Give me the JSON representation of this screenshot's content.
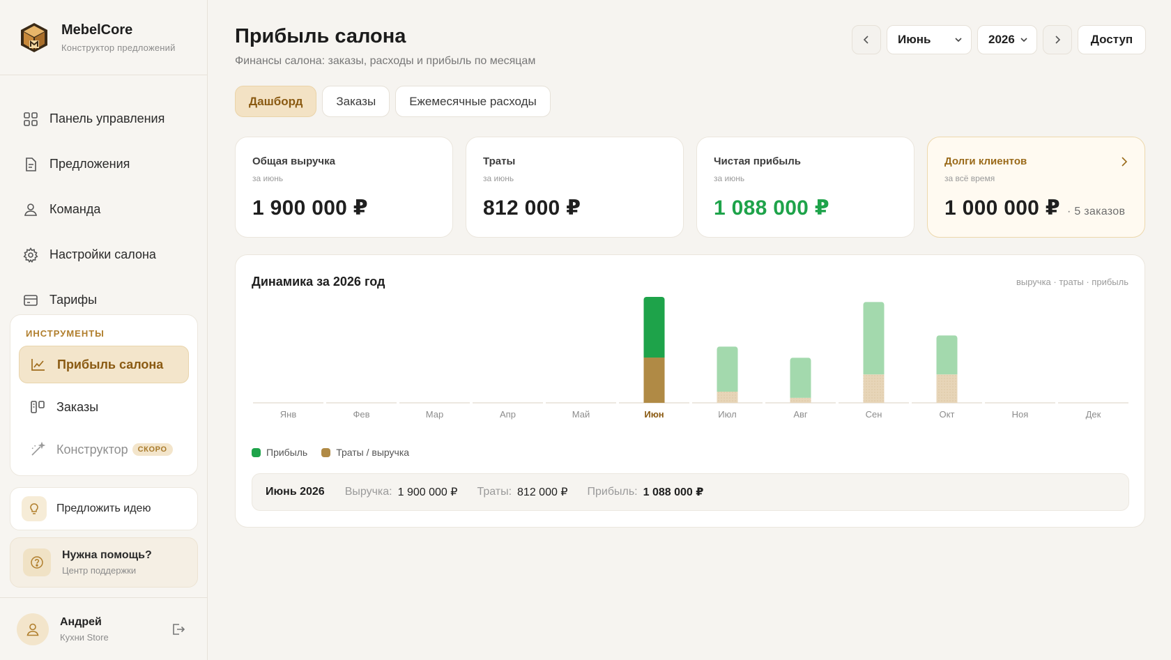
{
  "brand": {
    "name": "MebelCore",
    "subtitle": "Конструктор предложений"
  },
  "nav": [
    {
      "label": "Панель управления",
      "icon": "dashboard-icon"
    },
    {
      "label": "Предложения",
      "icon": "document-icon"
    },
    {
      "label": "Команда",
      "icon": "team-icon"
    },
    {
      "label": "Настройки салона",
      "icon": "gear-icon"
    },
    {
      "label": "Тарифы",
      "icon": "card-icon"
    }
  ],
  "tools": {
    "title": "ИНСТРУМЕНТЫ",
    "items": [
      {
        "label": "Прибыль салона",
        "icon": "chart-line-icon",
        "active": true
      },
      {
        "label": "Заказы",
        "icon": "kanban-icon"
      },
      {
        "label": "Конструктор",
        "icon": "wand-icon",
        "badge": "СКОРО"
      }
    ]
  },
  "idea": {
    "label": "Предложить идею",
    "icon": "bulb-icon"
  },
  "help": {
    "title": "Нужна помощь?",
    "subtitle": "Центр поддержки",
    "icon": "question-icon"
  },
  "user": {
    "name": "Андрей",
    "org": "Кухни Store"
  },
  "header": {
    "title": "Прибыль салона",
    "subtitle": "Финансы салона: заказы, расходы и прибыль по месяцам",
    "month": "Июнь",
    "year": "2026",
    "access_label": "Доступ"
  },
  "tabs": [
    {
      "label": "Дашборд",
      "active": true
    },
    {
      "label": "Заказы",
      "active": false
    },
    {
      "label": "Ежемесячные расходы",
      "active": false
    }
  ],
  "kpis": [
    {
      "label": "Общая выручка",
      "period": "за июнь",
      "value": "1 900 000 ₽"
    },
    {
      "label": "Траты",
      "period": "за июнь",
      "value": "812 000 ₽"
    },
    {
      "label": "Чистая прибыль",
      "period": "за июнь",
      "value": "1 088 000 ₽"
    },
    {
      "label": "Долги клиентов",
      "period": "за всё время",
      "value": "1 000 000 ₽",
      "extra": "· 5 заказов"
    }
  ],
  "colors": {
    "accent": "#b08a4a",
    "profit_active": "#1ea34a",
    "profit_muted": "#a3d9ad",
    "spend_active": "#b08a45",
    "spend_muted": "#e7d5b8"
  },
  "chart_data": {
    "type": "bar",
    "title": "Динамика за 2026 год",
    "note": "выручка · траты · прибыль",
    "categories": [
      "Янв",
      "Фев",
      "Мар",
      "Апр",
      "Май",
      "Июн",
      "Июл",
      "Авг",
      "Сен",
      "Окт",
      "Ноя",
      "Дек"
    ],
    "selected": "Июн",
    "series": [
      {
        "name": "Прибыль",
        "values": [
          0,
          0,
          0,
          0,
          0,
          1088000,
          810000,
          720000,
          1300000,
          700000,
          0,
          0
        ]
      },
      {
        "name": "Траты / выручка",
        "values": [
          0,
          0,
          0,
          0,
          0,
          812000,
          200000,
          90000,
          510000,
          510000,
          0,
          0
        ]
      }
    ],
    "stacked": true,
    "ylim": [
      0,
      1900000
    ]
  },
  "summary": {
    "month": "Июнь 2026",
    "revenue_label": "Выручка:",
    "revenue_value": "1 900 000 ₽",
    "spend_label": "Траты:",
    "spend_value": "812 000 ₽",
    "profit_label": "Прибыль:",
    "profit_value": "1 088 000 ₽"
  }
}
